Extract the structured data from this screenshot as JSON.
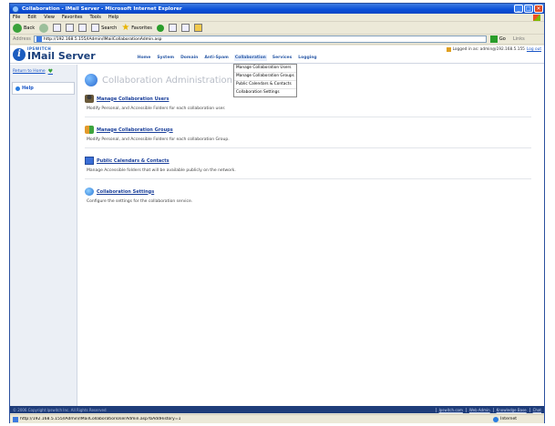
{
  "window": {
    "title": "Collaboration - IMail Server - Microsoft Internet Explorer",
    "min_glyph": "_",
    "max_glyph": "□",
    "close_glyph": "×"
  },
  "menu": [
    "File",
    "Edit",
    "View",
    "Favorites",
    "Tools",
    "Help"
  ],
  "toolbar": {
    "back_label": "Back",
    "search_label": "Search",
    "favorites_label": "Favorites"
  },
  "address": {
    "label": "Address",
    "url": "http://192.168.5.155/IAdmin/IMailCollaborationAdmin.asp",
    "go_label": "Go",
    "links_label": "Links"
  },
  "app": {
    "logo_small": "IPSWITCH",
    "logo_big": "IMail Server",
    "nav": [
      "Home",
      "System",
      "Domain",
      "Anti-Spam",
      "Collaboration",
      "Services",
      "Logging"
    ],
    "active_nav": "Collaboration",
    "login_text": "Logged in as: admin@192.168.5.155",
    "logout_label": "Log out"
  },
  "dropdown": [
    "Manage Collaboration Users",
    "Manage Collaboration Groups",
    "Public Calendars & Contacts",
    "Collaboration Settings"
  ],
  "sidebar": {
    "return_label": "Return to Home",
    "help_label": "Help"
  },
  "main": {
    "title": "Collaboration Administration",
    "sections": [
      {
        "title": "Manage Collaboration Users",
        "desc": "Modify Personal, and Accessible Folders for each collaboration user."
      },
      {
        "title": "Manage Collaboration Groups",
        "desc": "Modify Personal, and Accessible Folders for each collaboration Group."
      },
      {
        "title": "Public Calendars & Contacts",
        "desc": "Manage Accessible folders that will be available publicly on the network."
      },
      {
        "title": "Collaboration Settings",
        "desc": "Configure the settings for the collaboration service."
      }
    ]
  },
  "footer": {
    "copyright": "© 2006 Copyright Ipswitch Inc. All Rights Reserved",
    "links": [
      "Ipswitch.com",
      "Web Admin",
      "Knowledge Base",
      "Chat"
    ]
  },
  "status": {
    "url": "http://192.168.5.155/IAdmin/IMailCollaborationUserAdmin.asp?bAddHistory=1",
    "zone": "Internet"
  }
}
